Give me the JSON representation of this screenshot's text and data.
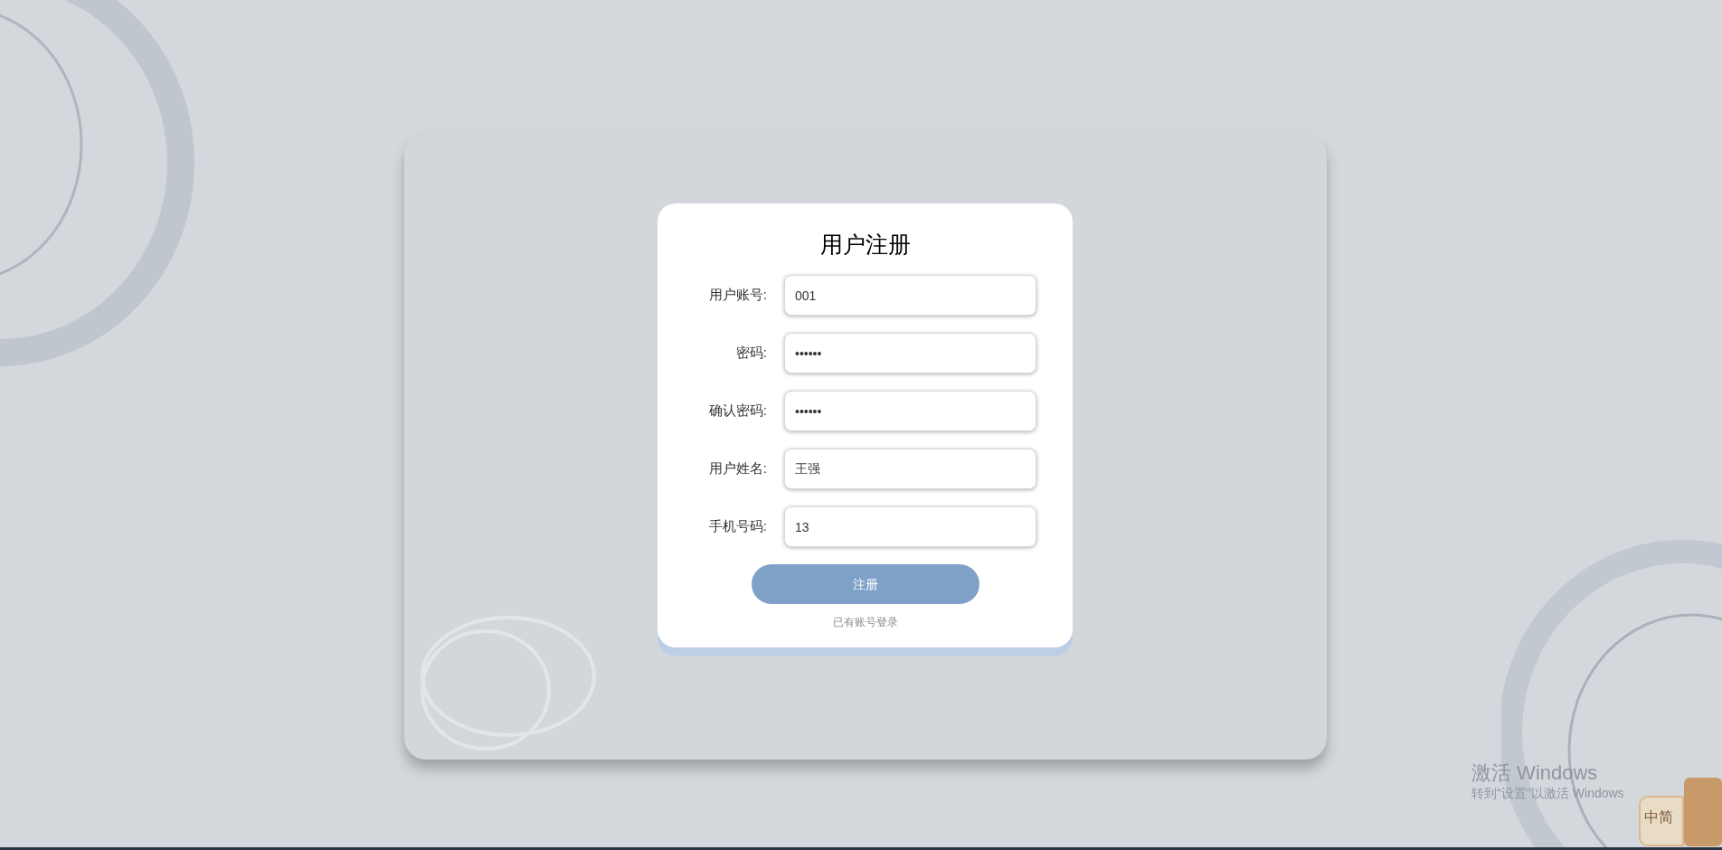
{
  "form": {
    "title": "用户注册",
    "fields": [
      {
        "label": "用户账号:",
        "value": "001"
      },
      {
        "label": "密码:",
        "value": "••••••"
      },
      {
        "label": "确认密码:",
        "value": "••••••"
      },
      {
        "label": "用户姓名:",
        "value": "王强"
      },
      {
        "label": "手机号码:",
        "value": "13"
      }
    ],
    "submit": "注册",
    "login_link": "已有账号登录"
  },
  "os_notice": {
    "title": "激活 Windows",
    "subtitle": "转到\"设置\"以激活 Windows"
  },
  "ime_widget": {
    "language": "中",
    "mode": "简"
  }
}
